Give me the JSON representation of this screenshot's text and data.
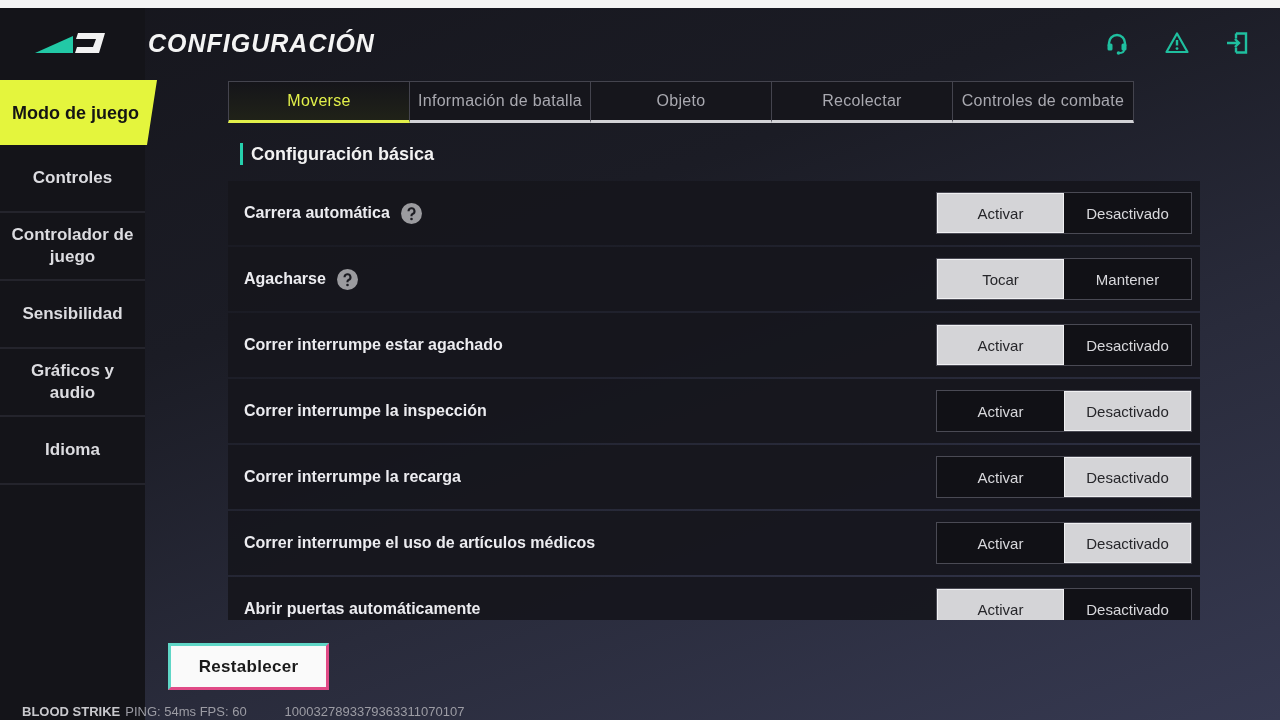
{
  "header": {
    "title": "CONFIGURACIÓN"
  },
  "sidebar": {
    "items": [
      {
        "label": "Modo de juego",
        "selected": true
      },
      {
        "label": "Controles",
        "selected": false
      },
      {
        "label": "Controlador de juego",
        "selected": false
      },
      {
        "label": "Sensibilidad",
        "selected": false
      },
      {
        "label": "Gráficos y audio",
        "selected": false
      },
      {
        "label": "Idioma",
        "selected": false
      }
    ]
  },
  "tabs": [
    {
      "label": "Moverse",
      "selected": true
    },
    {
      "label": "Información de batalla",
      "selected": false
    },
    {
      "label": "Objeto",
      "selected": false
    },
    {
      "label": "Recolectar",
      "selected": false
    },
    {
      "label": "Controles de combate",
      "selected": false
    }
  ],
  "section": {
    "title": "Configuración básica"
  },
  "settings": [
    {
      "label": "Carrera automática",
      "help": true,
      "options": [
        {
          "label": "Activar",
          "selected": true
        },
        {
          "label": "Desactivado",
          "selected": false
        }
      ]
    },
    {
      "label": "Agacharse",
      "help": true,
      "options": [
        {
          "label": "Tocar",
          "selected": true
        },
        {
          "label": "Mantener",
          "selected": false
        }
      ]
    },
    {
      "label": "Correr interrumpe estar agachado",
      "help": false,
      "options": [
        {
          "label": "Activar",
          "selected": true
        },
        {
          "label": "Desactivado",
          "selected": false
        }
      ]
    },
    {
      "label": "Correr interrumpe la inspección",
      "help": false,
      "options": [
        {
          "label": "Activar",
          "selected": false
        },
        {
          "label": "Desactivado",
          "selected": true
        }
      ]
    },
    {
      "label": "Correr interrumpe la recarga",
      "help": false,
      "options": [
        {
          "label": "Activar",
          "selected": false
        },
        {
          "label": "Desactivado",
          "selected": true
        }
      ]
    },
    {
      "label": "Correr interrumpe el uso de artículos médicos",
      "help": false,
      "options": [
        {
          "label": "Activar",
          "selected": false
        },
        {
          "label": "Desactivado",
          "selected": true
        }
      ]
    },
    {
      "label": "Abrir puertas automáticamente",
      "help": false,
      "options": [
        {
          "label": "Activar",
          "selected": true
        },
        {
          "label": "Desactivado",
          "selected": false
        }
      ]
    }
  ],
  "reset_button": "Restablecer",
  "status_bar": {
    "game": "BLOOD STRIKE",
    "stats": "PING: 54ms FPS: 60",
    "player_id": "1000327893379363311070107"
  }
}
